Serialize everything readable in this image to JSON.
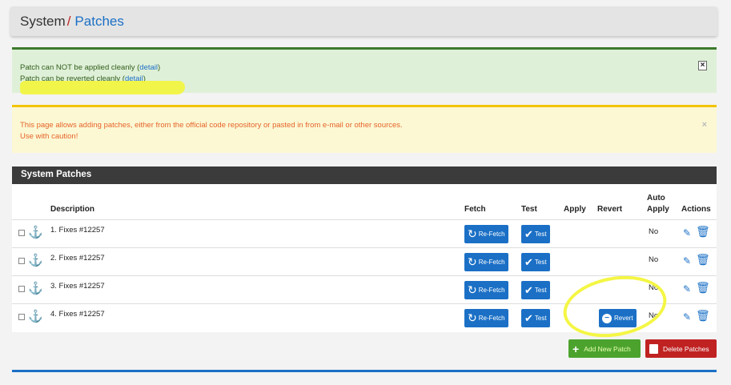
{
  "breadcrumb": {
    "parent": "System",
    "separator": "/",
    "current": "Patches"
  },
  "alerts": {
    "success": {
      "line1_prefix": "Patch can NOT be applied cleanly (",
      "line1_link": "detail",
      "line1_suffix": ")",
      "line2_prefix": "Patch can be reverted cleanly (",
      "line2_link": "detail",
      "line2_suffix": ")",
      "close": "×"
    },
    "warning": {
      "line1": "This page allows adding patches, either from the official code repository or pasted in from e-mail or other sources.",
      "line2": "Use with caution!",
      "close": "×"
    }
  },
  "panel": {
    "title": "System Patches",
    "columns": {
      "description": "Description",
      "fetch": "Fetch",
      "test": "Test",
      "apply": "Apply",
      "revert": "Revert",
      "auto_apply_1": "Auto",
      "auto_apply_2": "Apply",
      "actions": "Actions"
    },
    "rows": [
      {
        "description": "1. Fixes #12257",
        "fetch": "Re-Fetch",
        "test": "Test",
        "revert": "",
        "auto_apply": "No"
      },
      {
        "description": "2. Fixes #12257",
        "fetch": "Re-Fetch",
        "test": "Test",
        "revert": "",
        "auto_apply": "No"
      },
      {
        "description": "3. Fixes #12257",
        "fetch": "Re-Fetch",
        "test": "Test",
        "revert": "",
        "auto_apply": "No"
      },
      {
        "description": "4. Fixes #12257",
        "fetch": "Re-Fetch",
        "test": "Test",
        "revert": "Revert",
        "auto_apply": "No"
      }
    ]
  },
  "buttons": {
    "add": "Add New Patch",
    "delete": "Delete Patches"
  },
  "icons": {
    "row_anchor": "anchor-icon",
    "fetch": "refresh-icon",
    "test": "check-icon",
    "revert": "minus-circle-icon",
    "edit": "pencil-icon",
    "delete": "trash-icon",
    "add": "plus-icon"
  },
  "colors": {
    "link": "#1b70c6",
    "success": "#4ba32d",
    "danger": "#c02222",
    "highlight": "#f3f53a"
  }
}
